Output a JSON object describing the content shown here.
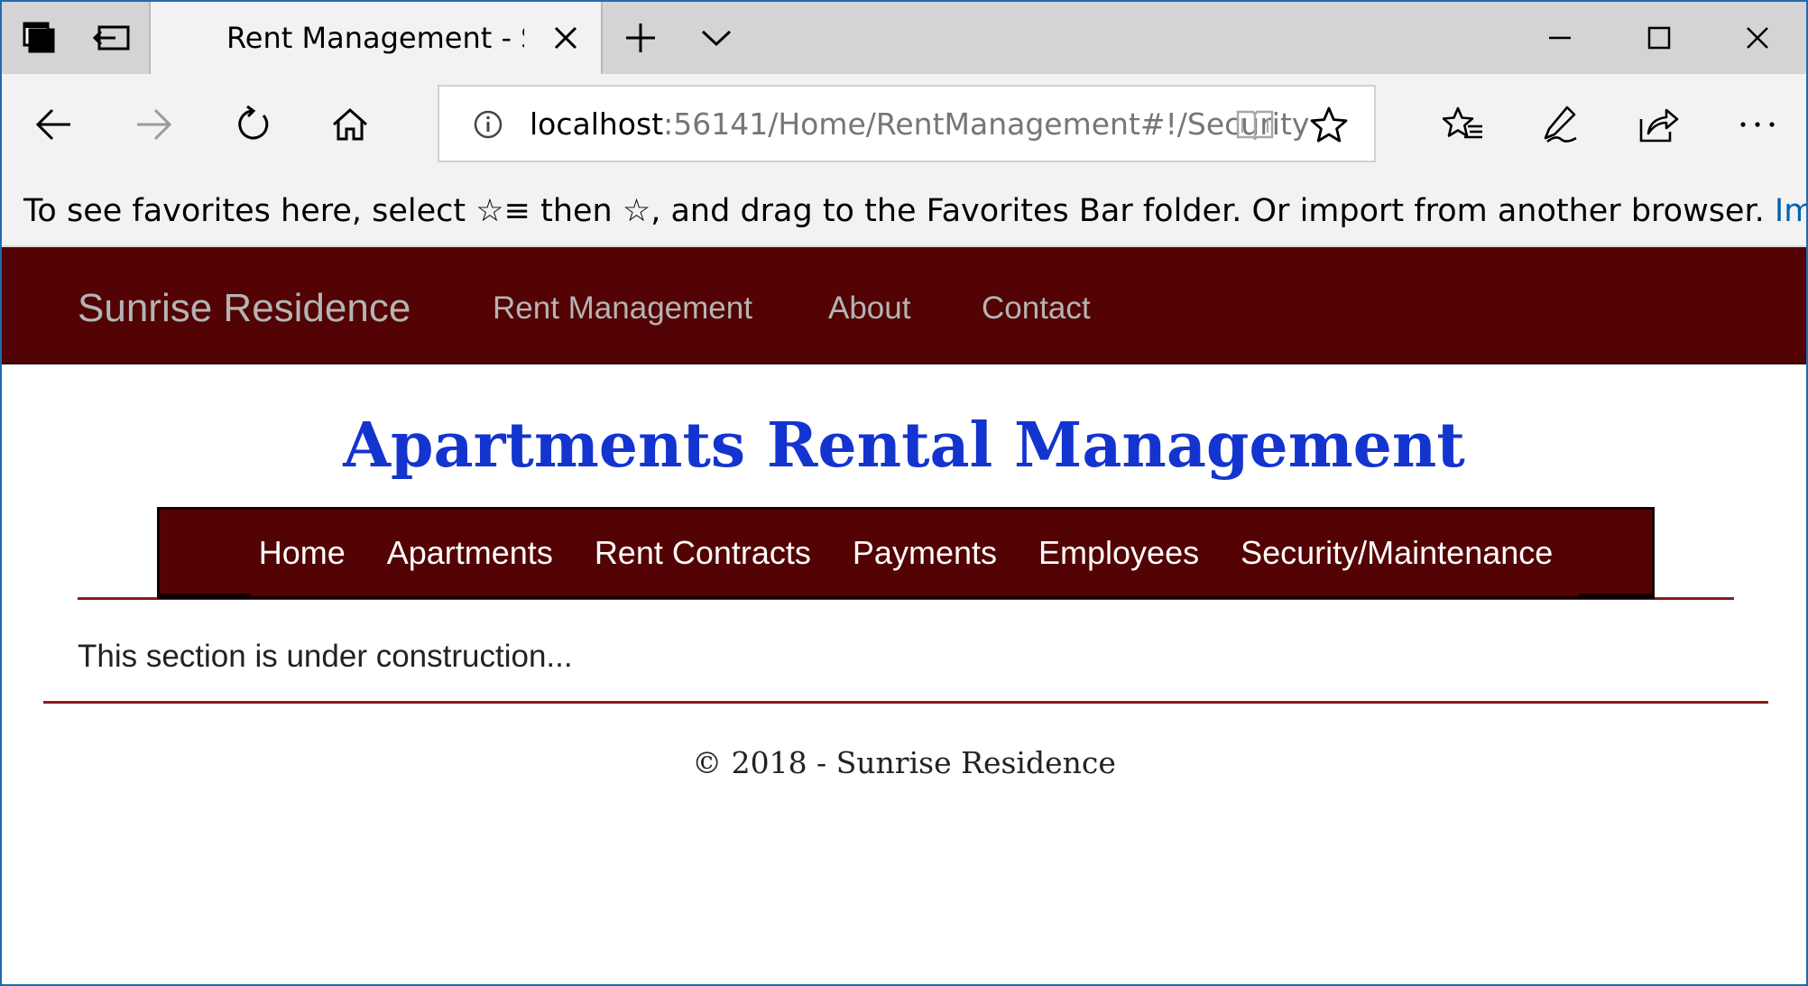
{
  "browser": {
    "tab_title": "Rent Management - Sunrise Residence",
    "new_tab_symbol": "+",
    "address": {
      "host": "localhost",
      "path": ":56141/Home/RentManagement#!/Security"
    },
    "favorites_bar": {
      "message_start": "To see favorites here, select ",
      "message_icon": "☆≡",
      "message_mid": " then ☆, and drag to the Favorites Bar folder. Or import from another browser. ",
      "import_link": "Import favorites"
    },
    "icons": {
      "tab_manager": "tab-manager-icon",
      "set_aside": "set-aside-tabs-icon",
      "close_tab": "close-icon",
      "new_tab": "plus-icon",
      "tab_preview": "chevron-down-icon",
      "minimize": "minimize-icon",
      "maximize": "maximize-icon",
      "close_window": "close-icon",
      "back": "back-arrow-icon",
      "forward": "forward-arrow-icon",
      "refresh": "refresh-icon",
      "home": "home-icon",
      "info": "info-icon",
      "reading_view": "reading-view-icon",
      "favorite_star": "star-icon",
      "favorites_hub": "favorites-hub-icon",
      "web_note": "pen-icon",
      "share": "share-icon",
      "more": "more-icon"
    }
  },
  "site": {
    "brand": "Sunrise Residence",
    "nav": [
      "Rent Management",
      "About",
      "Contact"
    ],
    "page_title": "Apartments Rental Management",
    "menu": [
      "Home",
      "Apartments",
      "Rent Contracts",
      "Payments",
      "Employees",
      "Security/Maintenance"
    ],
    "content": "This section is under construction...",
    "footer": "© 2018 - Sunrise Residence"
  },
  "colors": {
    "header_bg": "#530303",
    "title_blue": "#1334cf",
    "rule_red": "#8f1a1a",
    "link_blue": "#0063b1"
  }
}
